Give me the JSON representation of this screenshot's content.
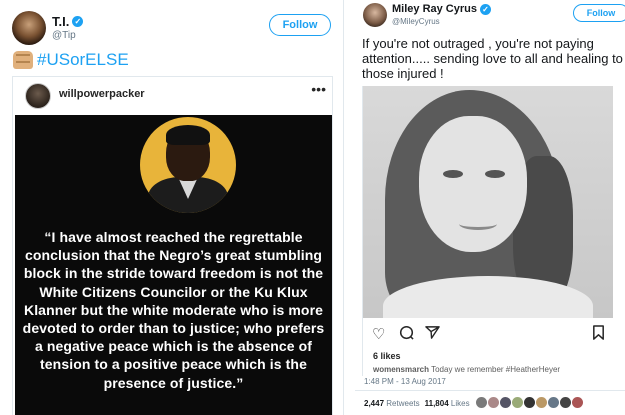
{
  "left_tweet": {
    "name": "T.I.",
    "handle": "@Tip",
    "follow_label": "Follow",
    "hashtag": "#USorELSE",
    "instagram": {
      "username": "willpowerpacker",
      "more": "•••",
      "quote": "“I have almost reached the regrettable conclusion that the Negro’s great stumbling block in the stride toward freedom is not the White Citizens Councilor or the Ku Klux Klanner but the white moderate who is more devoted to order than to justice; who prefers a negative peace which is the absence of tension to a positive peace which is the presence of justice.”"
    }
  },
  "right_tweet": {
    "name": "Miley Ray Cyrus",
    "handle": "@MileyCyrus",
    "follow_label": "Follow",
    "text": "If you're not outraged , you're not paying attention..... sending love to all and healing to those injured !",
    "instagram": {
      "likes": "6 likes",
      "caption_user": "womensmarch",
      "caption_text": " Today we remember #HeatherHeyer",
      "icons": {
        "heart": "heart-icon",
        "comment": "comment-icon",
        "share": "share-icon",
        "bookmark": "bookmark-icon"
      }
    },
    "timestamp": "1:48 PM - 13 Aug 2017",
    "retweets_count": "2,447",
    "retweets_label": "Retweets",
    "likes_count": "11,804",
    "likes_label": "Likes"
  },
  "colors": {
    "twitter_blue": "#1da1f2",
    "text": "#14171a",
    "muted": "#657786",
    "quote_bg": "#0a0a0a",
    "mlk_circle": "#e8b43a"
  }
}
